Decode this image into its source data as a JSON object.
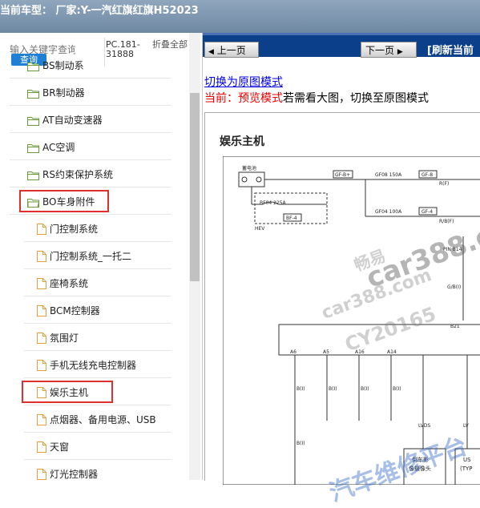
{
  "header": {
    "title": "当前车型： 厂家:Y-一汽红旗红旗H52023"
  },
  "search": {
    "placeholder": "输入关键字查询",
    "button_label": "查询"
  },
  "code_label": "PC.181-31888",
  "collapse_all": "折叠全部",
  "tree": {
    "items": [
      {
        "label": "BS制动系",
        "type": "folder"
      },
      {
        "label": "BR制动器",
        "type": "folder"
      },
      {
        "label": "AT自动变速器",
        "type": "folder"
      },
      {
        "label": "AC空调",
        "type": "folder"
      },
      {
        "label": "RS约束保护系统",
        "type": "folder"
      },
      {
        "label": "BO车身附件",
        "type": "folder-open",
        "highlighted": true
      },
      {
        "label": "门控制系统",
        "type": "file"
      },
      {
        "label": "门控制系统_一托二",
        "type": "file"
      },
      {
        "label": "座椅系统",
        "type": "file"
      },
      {
        "label": "BCM控制器",
        "type": "file"
      },
      {
        "label": "氛围灯",
        "type": "file"
      },
      {
        "label": "手机无线充电控制器",
        "type": "file"
      },
      {
        "label": "娱乐主机",
        "type": "file",
        "highlighted": true
      },
      {
        "label": "点烟器、备用电源、USB",
        "type": "file"
      },
      {
        "label": "天窗",
        "type": "file"
      },
      {
        "label": "灯光控制器",
        "type": "file"
      }
    ]
  },
  "nav": {
    "prev": "上一页",
    "next": "下一页",
    "refresh": "[刷新当前"
  },
  "view": {
    "switch_link": "切换为原图模式",
    "mode_prefix": "当前：",
    "mode_current": "预览模式",
    "mode_hint": "若需看大图，切换至原图模式"
  },
  "document": {
    "title": "娱乐主机",
    "labels": {
      "battery": "蓄电池",
      "gf_b": "GF-B+",
      "gf08": "GF08 150A",
      "gf8": "GF-8",
      "rf": "R(F)",
      "bf04": "BF04 225A",
      "bf4": "BF-4",
      "hev": "HEV",
      "gf04": "GF04 100A",
      "gf4": "GF-4",
      "rbf": "R/B(F)",
      "pin": "PIN B14",
      "gb": "G/B(I)",
      "b21": "B21",
      "a6": "A6",
      "a5": "A5",
      "a16": "A16",
      "a14": "A14",
      "bi": "B(I)",
      "lvds": "LVDS",
      "lv": "LV",
      "cam": "倒车影",
      "cam2": "像摄像头",
      "us": "US",
      "typ": "(TYP"
    }
  },
  "watermark": {
    "line1": "畅易",
    "line2": "car388.com",
    "line3": "car388.com",
    "line4": "CY20165",
    "line5": "汽车维修平台"
  },
  "colors": {
    "header_bg": "#7a92ab",
    "nav_bg": "#0b3f8a",
    "search_button": "#1e7fd4",
    "highlight": "#e0302e",
    "link": "#0000ee"
  }
}
